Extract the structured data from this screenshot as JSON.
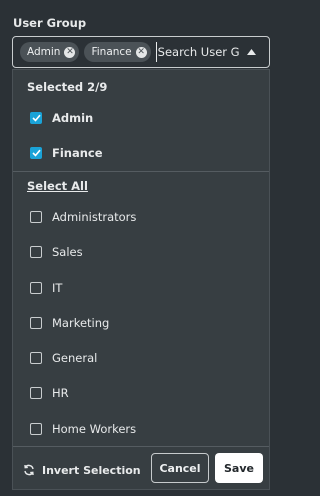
{
  "field": {
    "label": "User Group",
    "placeholder": "Search User G"
  },
  "chips": [
    {
      "label": "Admin"
    },
    {
      "label": "Finance"
    }
  ],
  "panel": {
    "selected_count": "Selected 2/9",
    "selected_options": [
      {
        "label": "Admin",
        "checked": true
      },
      {
        "label": "Finance",
        "checked": true
      }
    ],
    "select_all_label": "Select All",
    "options": [
      {
        "label": "Administrators",
        "checked": false
      },
      {
        "label": "Sales",
        "checked": false
      },
      {
        "label": "IT",
        "checked": false
      },
      {
        "label": "Marketing",
        "checked": false
      },
      {
        "label": "General",
        "checked": false
      },
      {
        "label": "HR",
        "checked": false
      },
      {
        "label": "Home Workers",
        "checked": false
      }
    ]
  },
  "footer": {
    "invert_label": "Invert Selection",
    "cancel_label": "Cancel",
    "save_label": "Save"
  },
  "colors": {
    "background": "#2b3136",
    "panel": "#373e42",
    "checkbox_checked": "#1aa3d8"
  },
  "icons": {
    "chip_remove": "close-circle-icon",
    "dropdown": "caret-up-icon",
    "checked": "checkmark-icon",
    "invert": "refresh-icon"
  }
}
